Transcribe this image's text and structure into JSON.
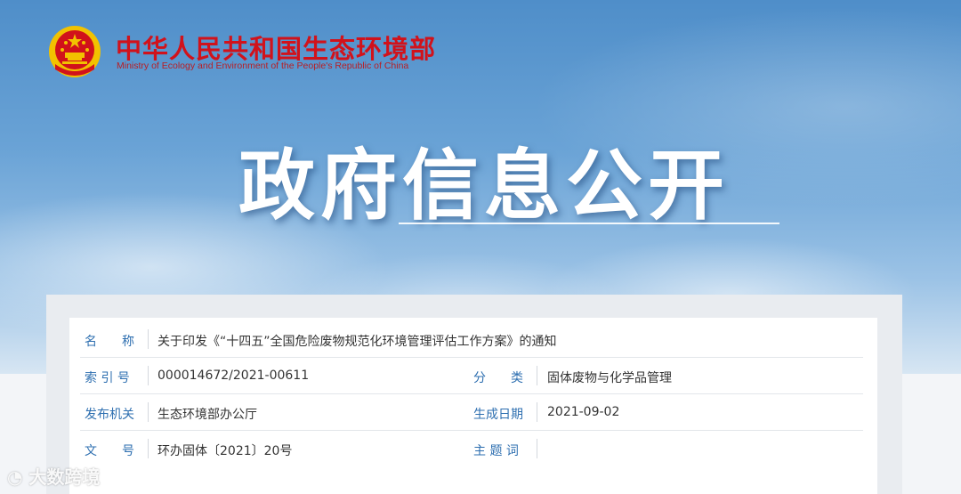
{
  "header": {
    "ministry_cn": "中华人民共和国生态环境部",
    "ministry_en": "Ministry of Ecology and Environment of the People's Republic of China",
    "emblem_icon": "national-emblem-icon"
  },
  "hero": {
    "title": "政府信息公开"
  },
  "info": {
    "name": {
      "label": "名　　称",
      "value": "关于印发《“十四五”全国危险废物规范化环境管理评估工作方案》的通知"
    },
    "index_no": {
      "label": "索 引 号",
      "value": "000014672/2021-00611"
    },
    "category": {
      "label": "分　　类",
      "value": "固体废物与化学品管理"
    },
    "issuer": {
      "label": "发布机关",
      "value": "生态环境部办公厅"
    },
    "date": {
      "label": "生成日期",
      "value": "2021-09-02"
    },
    "doc_no": {
      "label": "文　　号",
      "value": "环办固体〔2021〕20号"
    },
    "keywords": {
      "label": "主 题 词",
      "value": ""
    }
  },
  "watermark": {
    "text": "大数跨境"
  },
  "colors": {
    "brand_red": "#d1121b",
    "label_blue": "#2e6fb0",
    "sky_blue": "#4f8ec9"
  }
}
